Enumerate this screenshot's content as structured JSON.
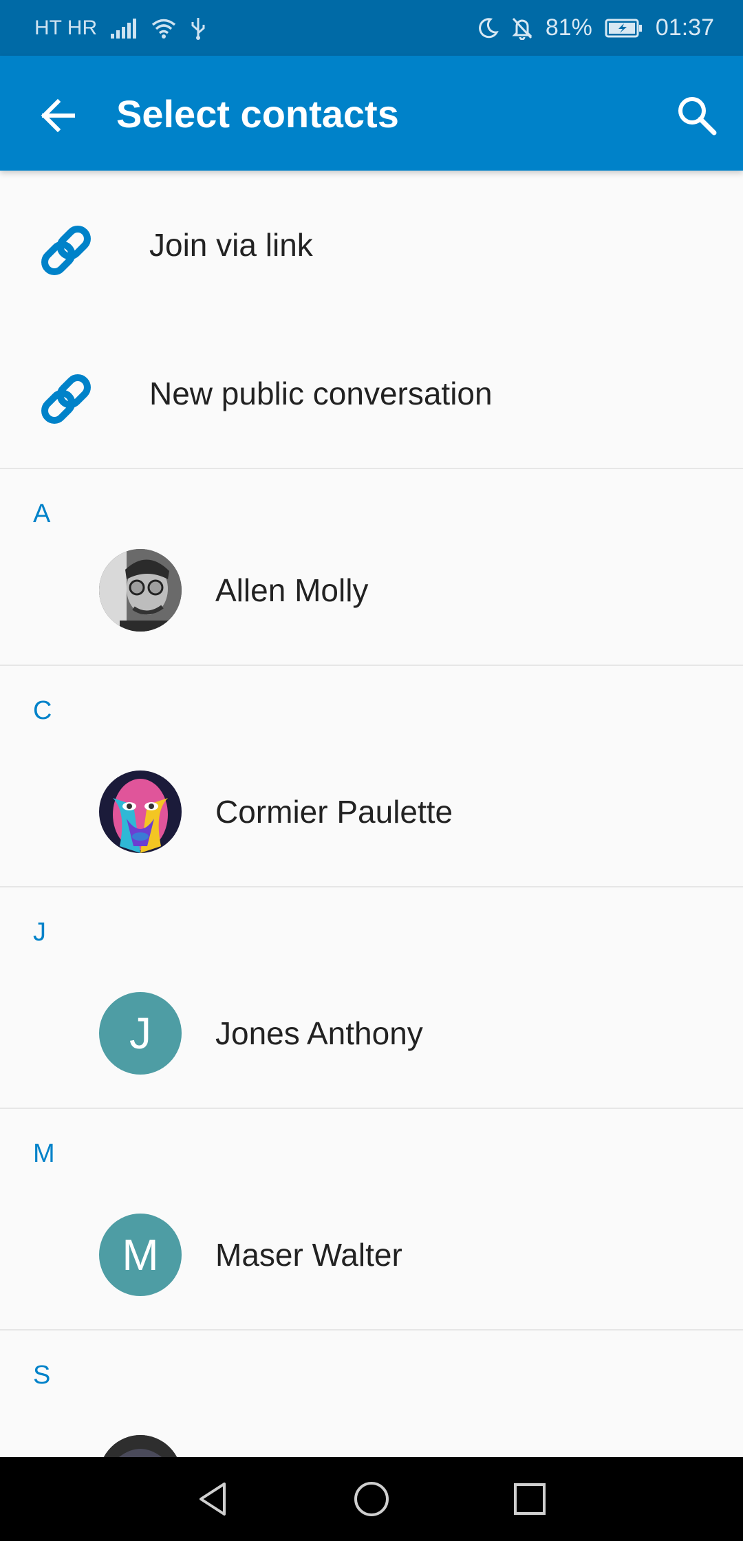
{
  "status_bar": {
    "carrier": "HT HR",
    "battery": "81%",
    "time": "01:37"
  },
  "app_bar": {
    "title": "Select contacts",
    "back_icon": "arrow-back-icon",
    "search_icon": "search-icon"
  },
  "menu": [
    {
      "label": "Join via link",
      "icon": "link-icon"
    },
    {
      "label": "New public conversation",
      "icon": "link-icon"
    }
  ],
  "sections": [
    {
      "letter": "A",
      "contact": {
        "name": "Allen Molly",
        "avatar_type": "photo-bw"
      }
    },
    {
      "letter": "C",
      "contact": {
        "name": "Cormier Paulette",
        "avatar_type": "photo-color"
      }
    },
    {
      "letter": "J",
      "contact": {
        "name": "Jones Anthony",
        "avatar_initial": "J",
        "avatar_color": "#4e9da4"
      }
    },
    {
      "letter": "M",
      "contact": {
        "name": "Maser Walter",
        "avatar_initial": "M",
        "avatar_color": "#4e9da4"
      }
    },
    {
      "letter": "S",
      "contact": {
        "name": "",
        "avatar_type": "photo-partial"
      }
    }
  ],
  "colors": {
    "status_bar": "#006aa6",
    "app_bar": "#0082c9",
    "accent": "#0082c9",
    "background": "#fafafa"
  }
}
